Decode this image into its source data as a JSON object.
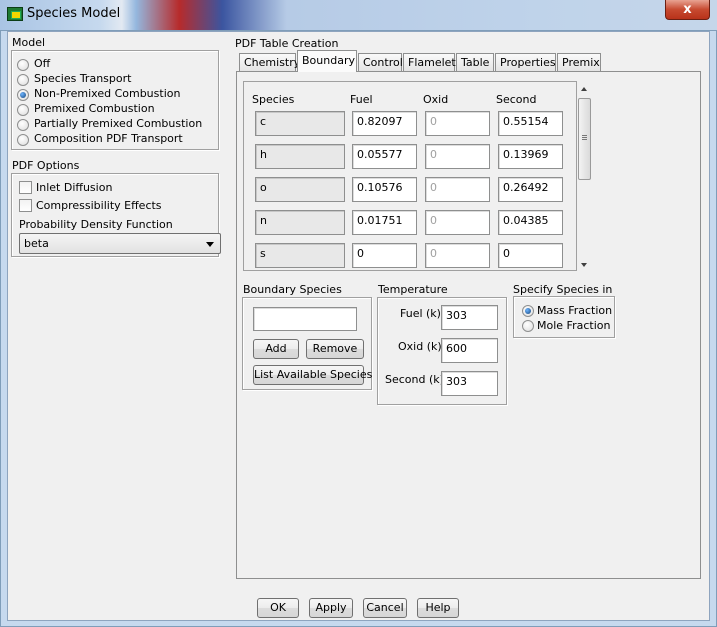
{
  "window": {
    "title": "Species Model",
    "close_glyph": "x"
  },
  "model": {
    "group_label": "Model",
    "options": [
      "Off",
      "Species Transport",
      "Non-Premixed Combustion",
      "Premixed Combustion",
      "Partially Premixed Combustion",
      "Composition PDF Transport"
    ],
    "selected": "Non-Premixed Combustion"
  },
  "pdf_options": {
    "group_label": "PDF Options",
    "inlet_diffusion": {
      "label": "Inlet Diffusion",
      "checked": false
    },
    "compressibility": {
      "label": "Compressibility Effects",
      "checked": false
    },
    "pdf_label": "Probability Density Function",
    "pdf_value": "beta"
  },
  "pdf_table": {
    "label": "PDF Table Creation",
    "tabs": [
      "Chemistry",
      "Boundary",
      "Control",
      "Flamelet",
      "Table",
      "Properties",
      "Premix"
    ],
    "active_tab": "Boundary"
  },
  "boundary_table": {
    "headers": [
      "Species",
      "Fuel",
      "Oxid",
      "Second"
    ],
    "rows": [
      {
        "species": "c",
        "fuel": "0.82097",
        "oxid": "0",
        "second": "0.55154"
      },
      {
        "species": "h",
        "fuel": "0.05577",
        "oxid": "0",
        "second": "0.13969"
      },
      {
        "species": "o",
        "fuel": "0.10576",
        "oxid": "0",
        "second": "0.26492"
      },
      {
        "species": "n",
        "fuel": "0.01751",
        "oxid": "0",
        "second": "0.04385"
      },
      {
        "species": "s",
        "fuel": "0",
        "oxid": "0",
        "second": "0"
      }
    ]
  },
  "boundary_species": {
    "label": "Boundary Species",
    "input_value": "",
    "add_label": "Add",
    "remove_label": "Remove",
    "list_label": "List Available Species"
  },
  "temperature": {
    "label": "Temperature",
    "fuel_label": "Fuel (k)",
    "fuel_value": "303",
    "oxid_label": "Oxid (k)",
    "oxid_value": "600",
    "second_label": "Second (k)",
    "second_value": "303"
  },
  "specify_species": {
    "label": "Specify Species in",
    "options": [
      "Mass Fraction",
      "Mole Fraction"
    ],
    "selected": "Mass Fraction"
  },
  "footer": {
    "ok": "OK",
    "apply": "Apply",
    "cancel": "Cancel",
    "help": "Help"
  },
  "colors": {
    "title_bar": "#c6d9ee",
    "dialog_bg": "#f0f0f0",
    "close_button": "#c74a30"
  }
}
